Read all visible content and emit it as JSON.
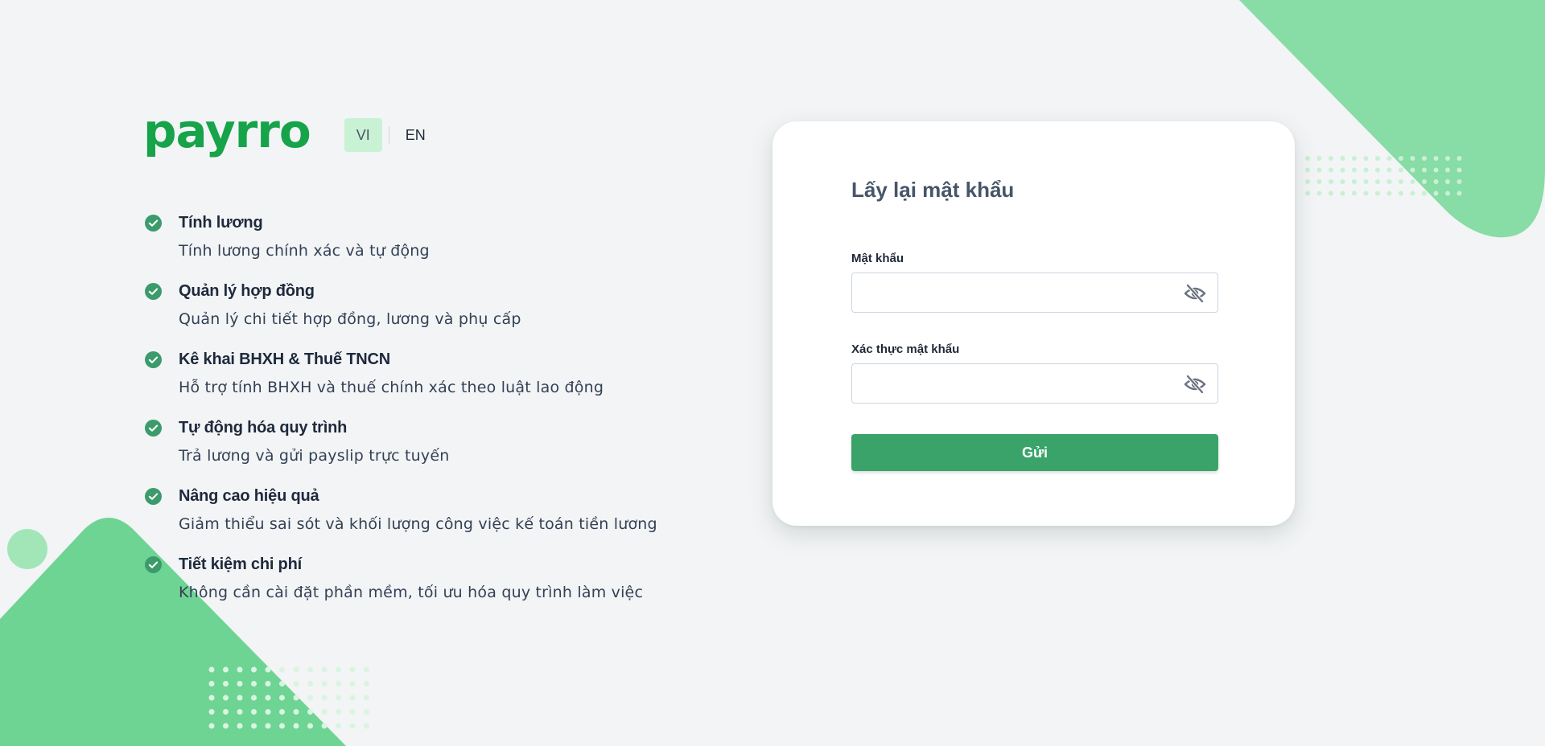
{
  "brand": {
    "logo_text": "payrro"
  },
  "language": {
    "options": [
      "VI",
      "EN"
    ],
    "selected": "VI"
  },
  "features": [
    {
      "title": "Tính lương",
      "description": "Tính lương chính xác và tự động"
    },
    {
      "title": "Quản lý hợp đồng",
      "description": "Quản lý chi tiết hợp đồng, lương và phụ cấp"
    },
    {
      "title": "Kê khai BHXH & Thuế TNCN",
      "description": "Hỗ trợ tính BHXH và thuế chính xác theo luật lao động"
    },
    {
      "title": "Tự động hóa quy trình",
      "description": "Trả lương và gửi payslip trực tuyến"
    },
    {
      "title": "Nâng cao hiệu quả",
      "description": "Giảm thiểu sai sót và khối lượng công việc kế toán tiền lương"
    },
    {
      "title": "Tiết kiệm chi phí",
      "description": "Không cần cài đặt phần mềm, tối ưu hóa quy trình làm việc"
    }
  ],
  "form": {
    "title": "Lấy lại mật khẩu",
    "password": {
      "label": "Mật khẩu",
      "value": "",
      "placeholder": ""
    },
    "confirm_password": {
      "label": "Xác thực mật khẩu",
      "value": "",
      "placeholder": ""
    },
    "submit_label": "Gửi"
  },
  "colors": {
    "brand_green": "#16a34a",
    "button_green": "#3aa36a",
    "check_green": "#3b9b6b",
    "decor_green": "#6ed493",
    "lang_active_bg": "#c9f2d5",
    "background": "#f3f4f6"
  },
  "icons": {
    "feature_check": "check-circle-icon",
    "password_toggle": "eye-slash-icon"
  }
}
